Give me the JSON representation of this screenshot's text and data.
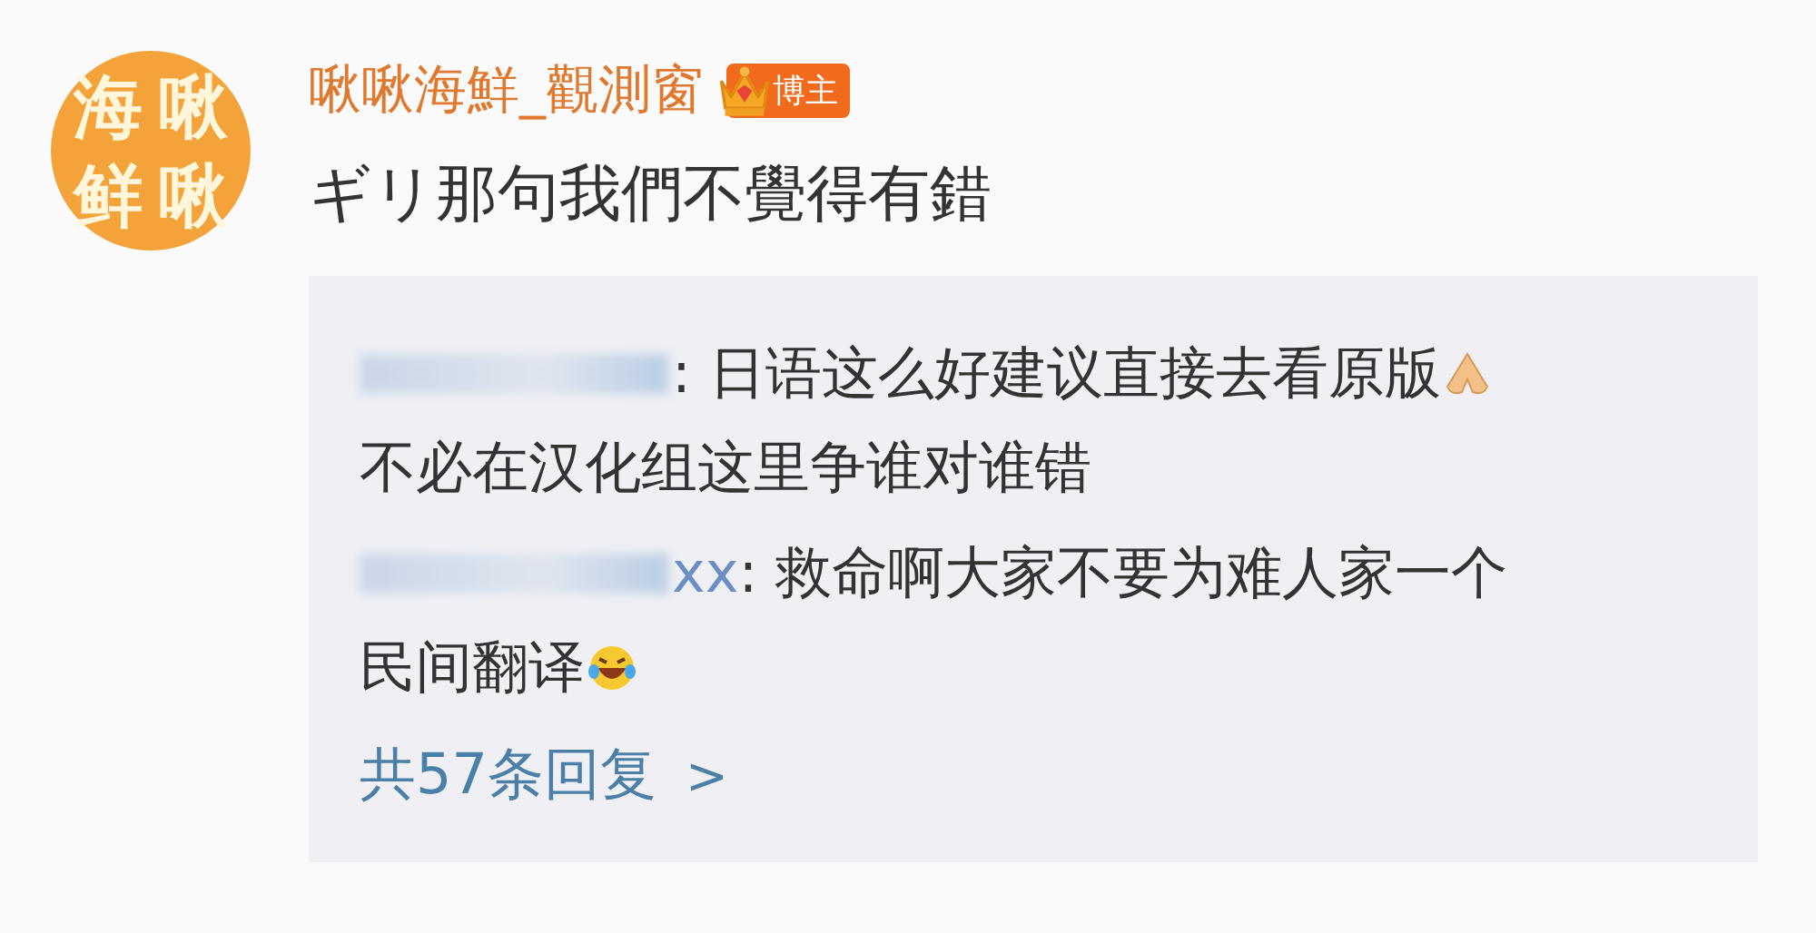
{
  "post": {
    "avatar": {
      "characters": [
        "海",
        "啾",
        "鲜",
        "啾"
      ]
    },
    "author": "啾啾海鮮_觀測窗",
    "badge": {
      "kind": "crown",
      "label": "博主"
    },
    "text": "ギリ那句我們不覺得有錯"
  },
  "replies": [
    {
      "lines": [
        {
          "text": ": 日语这么好建议直接去看原版",
          "emoji": {
            "kind": "hands"
          }
        },
        {
          "text": "不必在汉化组这里争谁对谁错"
        }
      ]
    },
    {
      "name_visible": "xx",
      "lines": [
        {
          "text": ": 救命啊大家不要为难人家一个"
        },
        {
          "text": "民间翻译",
          "emoji": {
            "kind": "laugh-cry"
          }
        }
      ]
    }
  ],
  "more_replies": {
    "label": "共57条回复",
    "arrow": ">"
  }
}
